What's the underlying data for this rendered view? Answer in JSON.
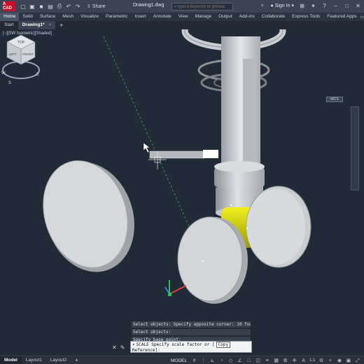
{
  "app": {
    "logo_text": "A CAD",
    "brand_color": "#c8102e"
  },
  "titlebar": {
    "share_label": "Share",
    "document_title": "Drawing1.dwg",
    "search_placeholder": "Type a keyword or phrase",
    "signin_label": "Sign In",
    "icons": [
      "new-icon",
      "open-icon",
      "save-icon",
      "save-as-icon",
      "print-icon",
      "undo-icon",
      "redo-icon",
      "share-icon",
      "search-icon",
      "user-icon",
      "cart-icon",
      "help-icon",
      "minimize-icon",
      "maximize-icon",
      "close-icon"
    ]
  },
  "ribbon": {
    "tabs": [
      "Home",
      "Solid",
      "Surface",
      "Mesh",
      "Visualize",
      "Parametric",
      "Insert",
      "Annotate",
      "View",
      "Manage",
      "Output",
      "Add-ins",
      "Collaborate",
      "Express Tools",
      "Featured Apps"
    ],
    "active_tab": "Home"
  },
  "file_tabs": {
    "tabs": [
      {
        "label": "Start",
        "active": false
      },
      {
        "label": "Drawing1*",
        "active": true
      }
    ],
    "close_glyph": "×",
    "add_glyph": "+"
  },
  "viewport": {
    "label": "[−][SW Isometric][Shaded]",
    "viewcube": {
      "faces": [
        "TOP",
        "LEFT",
        "FRONT"
      ],
      "compass": [
        "S",
        "W",
        "E"
      ]
    },
    "wcs_label": "WCS"
  },
  "command": {
    "history": [
      "Select objects: Specify opposite corner: 10 found",
      "Select objects:",
      "Specify base point:"
    ],
    "prompt": "SCALE Specify scale factor or [",
    "option": "Copy",
    "prompt_line2": "Reference]:"
  },
  "statusbar": {
    "layout_tabs": [
      {
        "label": "Model",
        "active": true
      },
      {
        "label": "Layout1",
        "active": false
      },
      {
        "label": "Layout2",
        "active": false
      }
    ],
    "add_glyph": "+",
    "model_label": "MODEL",
    "scale_label": "1:1"
  }
}
